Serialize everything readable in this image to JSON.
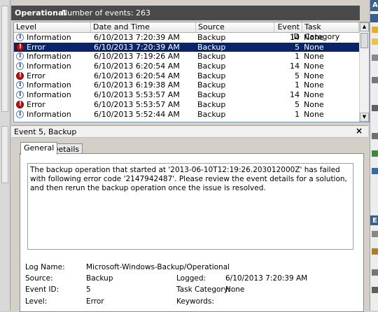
{
  "header": {
    "title": "Operational",
    "count_label": "Number of events: 263"
  },
  "table": {
    "columns": [
      "Level",
      "Date and Time",
      "Source",
      "Event ID",
      "Task Category"
    ],
    "rows": [
      {
        "level": "Information",
        "level_icon": "info-icon",
        "date": "6/10/2013 7:20:39 AM",
        "source": "Backup",
        "event_id": "14",
        "category": "None",
        "selected": false
      },
      {
        "level": "Error",
        "level_icon": "error-icon",
        "date": "6/10/2013 7:20:39 AM",
        "source": "Backup",
        "event_id": "5",
        "category": "None",
        "selected": true
      },
      {
        "level": "Information",
        "level_icon": "info-icon",
        "date": "6/10/2013 7:19:26 AM",
        "source": "Backup",
        "event_id": "1",
        "category": "None",
        "selected": false
      },
      {
        "level": "Information",
        "level_icon": "info-icon",
        "date": "6/10/2013 6:20:54 AM",
        "source": "Backup",
        "event_id": "14",
        "category": "None",
        "selected": false
      },
      {
        "level": "Error",
        "level_icon": "error-icon",
        "date": "6/10/2013 6:20:54 AM",
        "source": "Backup",
        "event_id": "5",
        "category": "None",
        "selected": false
      },
      {
        "level": "Information",
        "level_icon": "info-icon",
        "date": "6/10/2013 6:19:38 AM",
        "source": "Backup",
        "event_id": "1",
        "category": "None",
        "selected": false
      },
      {
        "level": "Information",
        "level_icon": "info-icon",
        "date": "6/10/2013 5:53:57 AM",
        "source": "Backup",
        "event_id": "14",
        "category": "None",
        "selected": false
      },
      {
        "level": "Error",
        "level_icon": "error-icon",
        "date": "6/10/2013 5:53:57 AM",
        "source": "Backup",
        "event_id": "5",
        "category": "None",
        "selected": false
      },
      {
        "level": "Information",
        "level_icon": "info-icon",
        "date": "6/10/2013 5:52:44 AM",
        "source": "Backup",
        "event_id": "1",
        "category": "None",
        "selected": false
      }
    ]
  },
  "details": {
    "title": "Event 5, Backup",
    "close_glyph": "×",
    "tabs": {
      "general": "General",
      "details": "Details"
    },
    "description": "The backup operation that started at '2013-06-10T12:19:26.203012000Z' has failed with following error code '2147942487'. Please review the event details for a solution, and then rerun the backup operation once the issue is resolved.",
    "fields": {
      "log_name_label": "Log Name:",
      "log_name": "Microsoft-Windows-Backup/Operational",
      "source_label": "Source:",
      "source": "Backup",
      "logged_label": "Logged:",
      "logged": "6/10/2013 7:20:39 AM",
      "event_id_label": "Event ID:",
      "event_id": "5",
      "task_category_label": "Task Category:",
      "task_category": "None",
      "level_label": "Level:",
      "level": "Error",
      "keywords_label": "Keywords:",
      "keywords": ""
    }
  },
  "colors": {
    "selected_row": "#0a246a",
    "header_bg": "#4a4a4a",
    "error": "#c01010",
    "info": "#2a4f9a",
    "actions_head": "#3b5f8f"
  },
  "right_panel": {
    "head_top": "A",
    "head_mid": "E"
  }
}
